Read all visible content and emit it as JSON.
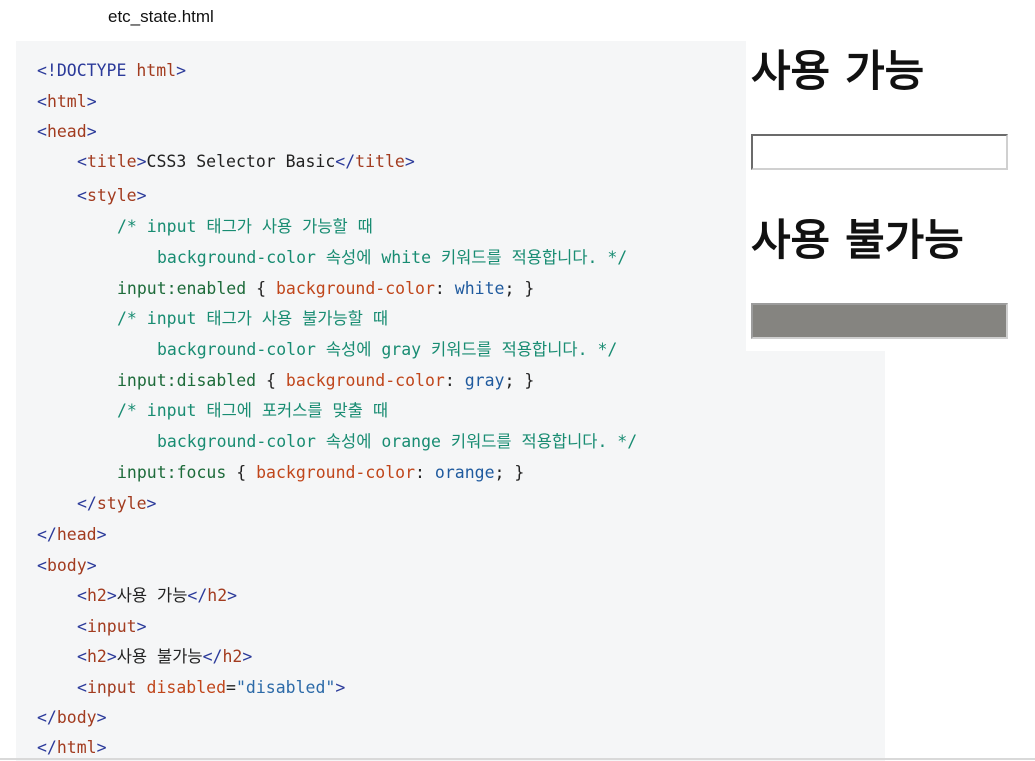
{
  "file": {
    "name": "etc_state.html"
  },
  "code": {
    "doctype": "<!DOCTYPE",
    "doctype_html": "html",
    "gt": ">",
    "lt": "<",
    "lt_slash": "</",
    "eq": "=",
    "semi": ";",
    "html": "html",
    "head": "head",
    "title": "title",
    "title_text": "CSS3 Selector Basic",
    "style": "style",
    "body": "body",
    "h2": "h2",
    "input": "input",
    "attr_disabled": "disabled",
    "str_disabled": "\"disabled\"",
    "h2_text_1": "사용 가능",
    "h2_text_2": "사용 불가능",
    "comment_1a": "/* input 태그가 사용 가능할 때",
    "comment_1b": "background-color 속성에 white 키워드를 적용합니다. */",
    "comment_2a": "/* input 태그가 사용 불가능할 때",
    "comment_2b": "background-color 속성에 gray 키워드를 적용합니다. */",
    "comment_3a": "/* input 태그에 포커스를 맞출 때",
    "comment_3b": "background-color 속성에 orange 키워드를 적용합니다. */",
    "selector_enabled": "input:enabled",
    "selector_disabled": "input:disabled",
    "selector_focus": "input:focus",
    "brace_open": " { ",
    "brace_close": " }",
    "property": "background-color",
    "colon": ": ",
    "value_white": "white",
    "value_gray": "gray",
    "value_orange": "orange"
  },
  "preview": {
    "heading_enabled": "사용 가능",
    "heading_disabled": "사용 불가능",
    "input_value": ""
  }
}
